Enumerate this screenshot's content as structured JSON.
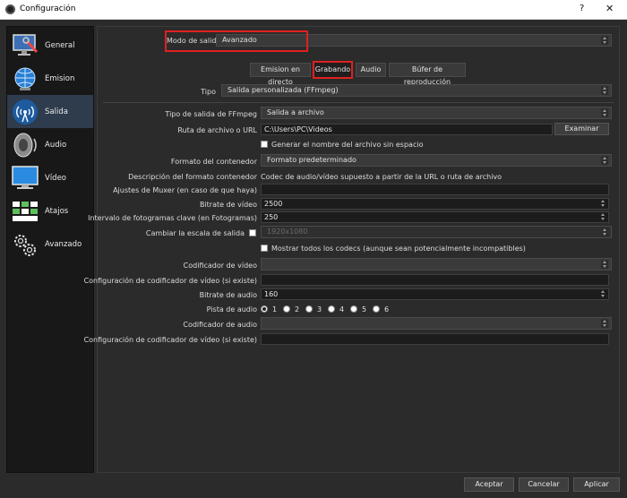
{
  "window": {
    "title": "Configuración",
    "help": "?",
    "close": "✕"
  },
  "sidebar": {
    "items": [
      {
        "label": "General",
        "icon": "monitor-wrench-icon"
      },
      {
        "label": "Emision",
        "icon": "globe-icon"
      },
      {
        "label": "Salida",
        "icon": "broadcast-icon",
        "active": true
      },
      {
        "label": "Audio",
        "icon": "speaker-icon"
      },
      {
        "label": "Vídeo",
        "icon": "monitor-icon"
      },
      {
        "label": "Atajos",
        "icon": "keyboard-icon"
      },
      {
        "label": "Avanzado",
        "icon": "gears-icon"
      }
    ]
  },
  "output_mode": {
    "label": "Modo de salida",
    "value": "Avanzado"
  },
  "tabs": [
    {
      "label": "Emision en directo"
    },
    {
      "label": "Grabando",
      "active": true
    },
    {
      "label": "Audio"
    },
    {
      "label": "Búfer de reproducción"
    }
  ],
  "recording": {
    "tipo": {
      "label": "Tipo",
      "value": "Salida personalizada (FFmpeg)"
    },
    "ffmpeg_output_type": {
      "label": "Tipo de salida de FFmpeg",
      "value": "Salida a archivo"
    },
    "file_path": {
      "label": "Ruta de archivo o URL",
      "value": "C:\\Users\\PC\\Videos",
      "browse": "Examinar"
    },
    "no_space": {
      "label": "Generar el nombre del archivo sin espacio",
      "checked": false
    },
    "container_format": {
      "label": "Formato del contenedor",
      "value": "Formato predeterminado"
    },
    "container_desc": {
      "label": "Descripción del formato contenedor",
      "value": "Codec de audio/vídeo supuesto a partir de la URL o ruta de archivo"
    },
    "muxer_settings": {
      "label": "Ajustes de Muxer (en caso de que haya)",
      "value": ""
    },
    "video_bitrate": {
      "label": "Bitrate de vídeo",
      "value": "2500"
    },
    "keyframe_interval": {
      "label": "Intervalo de fotogramas clave (en Fotogramas)",
      "value": "250"
    },
    "rescale": {
      "label": "Cambiar la escala de salida",
      "value": "1920x1080",
      "checked": false
    },
    "show_all_codecs": {
      "label": "Mostrar todos los codecs (aunque sean potencialmente incompatibles)",
      "checked": false
    },
    "video_encoder": {
      "label": "Codificador de vídeo",
      "value": ""
    },
    "video_encoder_settings": {
      "label": "Configuración de codificador de vídeo (si existe)",
      "value": ""
    },
    "audio_bitrate": {
      "label": "Bitrate de audio",
      "value": "160"
    },
    "audio_track": {
      "label": "Pista de audio",
      "options": [
        "1",
        "2",
        "3",
        "4",
        "5",
        "6"
      ],
      "selected": "1"
    },
    "audio_encoder": {
      "label": "Codificador de audio",
      "value": ""
    },
    "audio_encoder_settings": {
      "label": "Configuración de codificador de vídeo (si existe)",
      "value": ""
    }
  },
  "footer": {
    "accept": "Aceptar",
    "cancel": "Cancelar",
    "apply": "Aplicar"
  },
  "colors": {
    "highlight": "#e02020",
    "active_item": "#2f3c4d",
    "background": "#2b2b2b"
  }
}
